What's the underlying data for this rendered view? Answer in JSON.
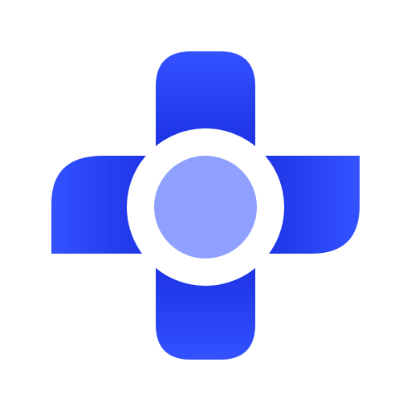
{
  "logo": {
    "icon": "medical-cross-icon",
    "colors": {
      "background": "#ffffff",
      "cross_primary": "#3352ff",
      "cross_dark": "#0a1fc4",
      "ring": "#ffffff",
      "center_dot": "#8fa0ff"
    }
  }
}
